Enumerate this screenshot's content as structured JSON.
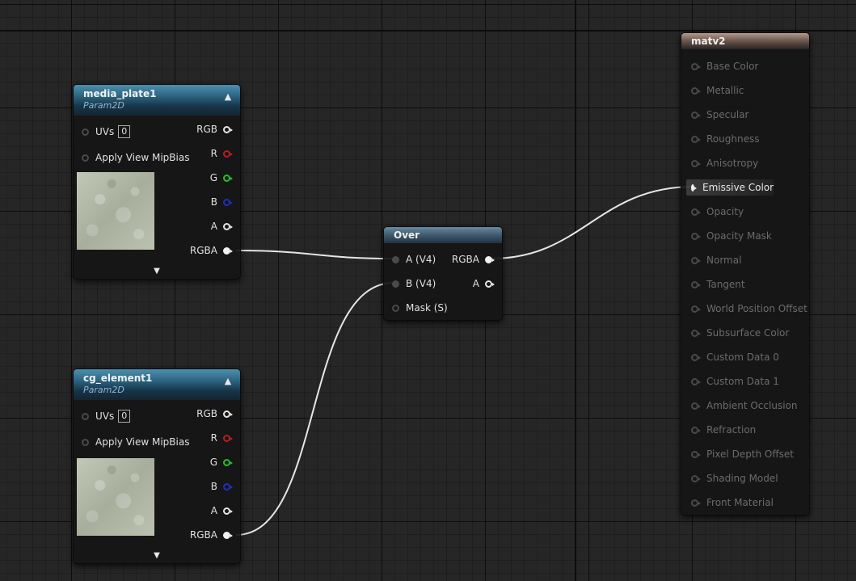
{
  "nodes": {
    "media_plate": {
      "title": "media_plate1",
      "subtitle": "Param2D",
      "uvs_label": "UVs",
      "uvs_value": "0",
      "mip_label": "Apply View MipBias",
      "outputs": [
        "RGB",
        "R",
        "G",
        "B",
        "A",
        "RGBA"
      ]
    },
    "cg_element": {
      "title": "cg_element1",
      "subtitle": "Param2D",
      "uvs_label": "UVs",
      "uvs_value": "0",
      "mip_label": "Apply View MipBias",
      "outputs": [
        "RGB",
        "R",
        "G",
        "B",
        "A",
        "RGBA"
      ]
    },
    "over": {
      "title": "Over",
      "inputs": [
        "A (V4)",
        "B (V4)",
        "Mask (S)"
      ],
      "outputs": [
        "RGBA",
        "A"
      ]
    },
    "material": {
      "title": "matv2",
      "inputs": [
        "Base Color",
        "Metallic",
        "Specular",
        "Roughness",
        "Anisotropy",
        "Emissive Color",
        "Opacity",
        "Opacity Mask",
        "Normal",
        "Tangent",
        "World Position Offset",
        "Subsurface Color",
        "Custom Data 0",
        "Custom Data 1",
        "Ambient Occlusion",
        "Refraction",
        "Pixel Depth Offset",
        "Shading Model",
        "Front Material"
      ],
      "active_input": "Emissive Color"
    }
  },
  "colors": {
    "param_header": "#2d6784",
    "over_header": "#3e5a6e",
    "material_header": "#6e5a50",
    "wire": "#e6e6e6",
    "pin_red": "#b81f1f",
    "pin_green": "#2cbd2c",
    "pin_blue": "#1f2fbf"
  },
  "icons": {
    "collapse": "chevron-up-icon",
    "expand": "chevron-down-icon",
    "pin": "pin-circle-icon"
  }
}
